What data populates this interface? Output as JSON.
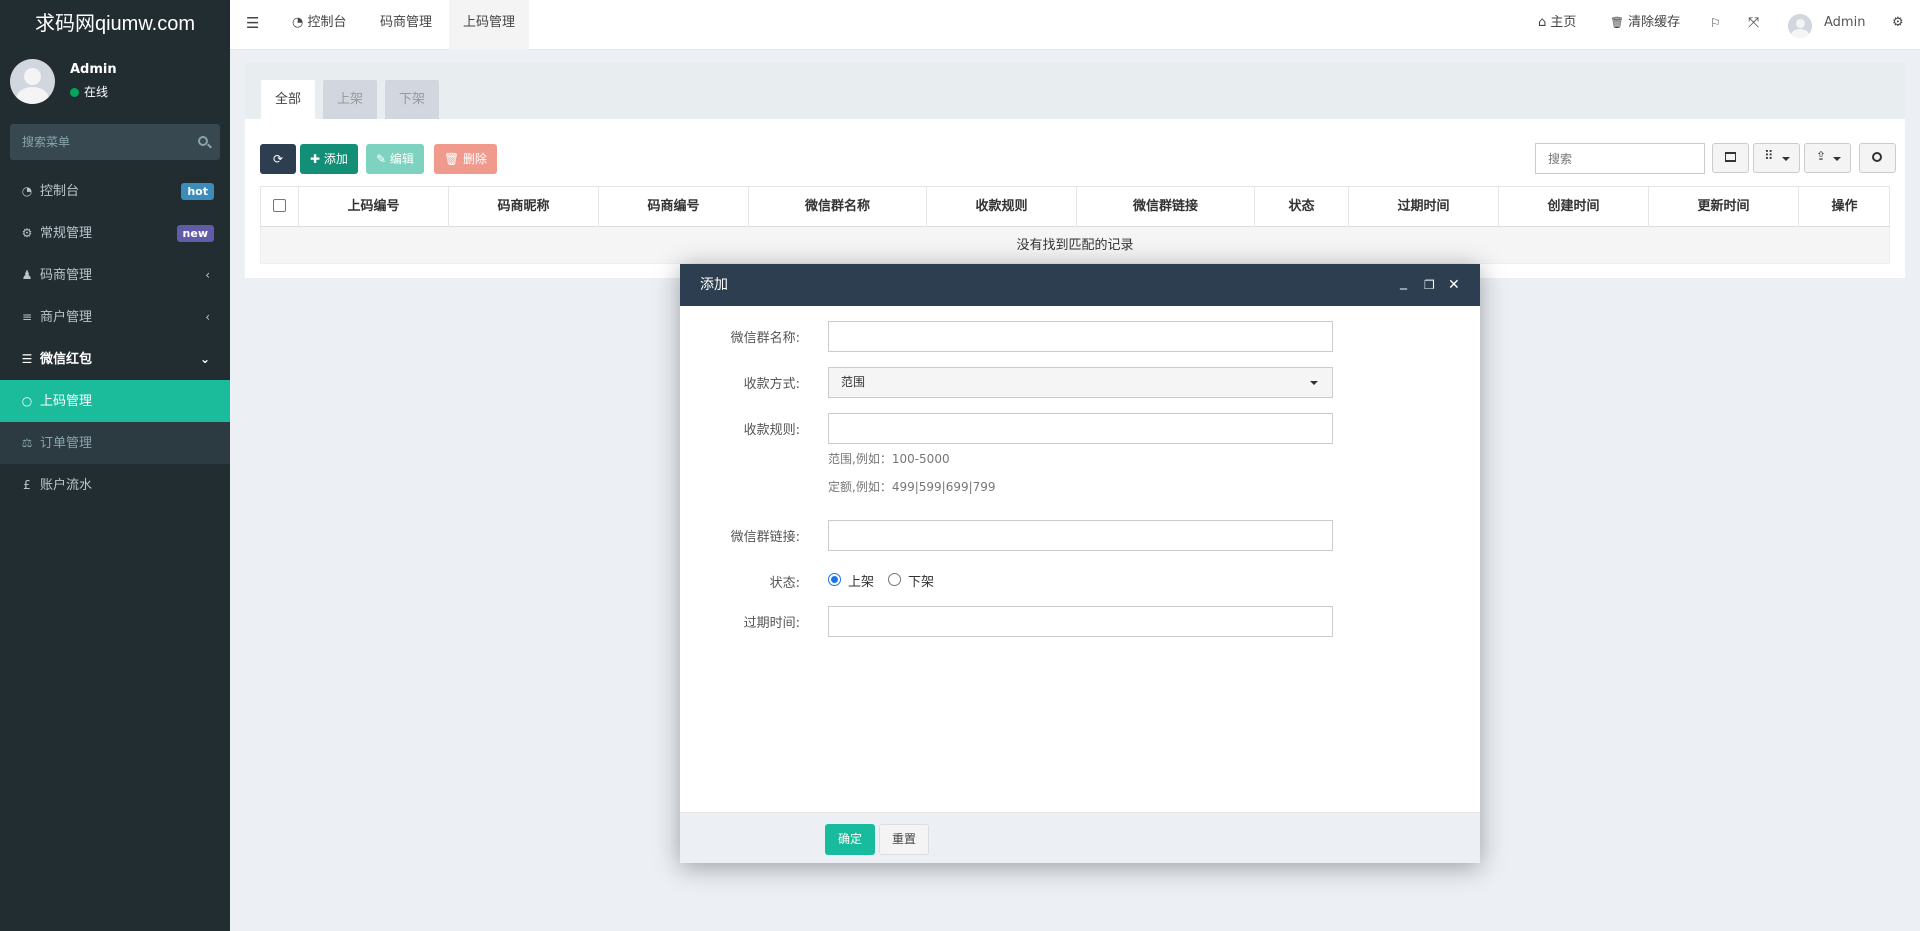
{
  "sidebar": {
    "logo": "求码网qiumw.com",
    "user_name": "Admin",
    "user_status": "在线",
    "search_placeholder": "搜索菜单",
    "items": [
      {
        "label": "控制台",
        "icon": "dashboard-icon",
        "glyph": "◔",
        "badge": "hot",
        "badge_color": "#3c8dbc"
      },
      {
        "label": "常规管理",
        "icon": "cogs-icon",
        "glyph": "⚙",
        "badge": "new",
        "badge_color": "#605ca8"
      },
      {
        "label": "码商管理",
        "icon": "users-icon",
        "glyph": "♟",
        "arrow": "‹"
      },
      {
        "label": "商户管理",
        "icon": "list-icon",
        "glyph": "≡",
        "arrow": "‹"
      },
      {
        "label": "微信红包",
        "icon": "database-icon",
        "glyph": "☰",
        "arrow": "⌄"
      },
      {
        "label": "上码管理",
        "icon": "circle-icon",
        "glyph": "○"
      },
      {
        "label": "订单管理",
        "icon": "balance-scale-icon",
        "glyph": "⚖"
      },
      {
        "label": "账户流水",
        "icon": "pound-icon",
        "glyph": "£"
      }
    ]
  },
  "header": {
    "menu_icon": "☰",
    "tabs": [
      {
        "label": "控制台",
        "icon": "dashboard-icon",
        "glyph": "◔"
      },
      {
        "label": "码商管理"
      },
      {
        "label": "上码管理"
      }
    ],
    "home_label": "主页",
    "home_glyph": "⌂",
    "clear_cache_label": "清除缓存",
    "clear_cache_glyph": "🗑",
    "user_name": "Admin"
  },
  "panel": {
    "tabs": [
      "全部",
      "上架",
      "下架"
    ],
    "buttons": {
      "add": "✚ 添加",
      "edit": "✎ 编辑",
      "delete": "🗑 删除"
    },
    "search_placeholder": "搜索",
    "columns": [
      "上码编号",
      "码商昵称",
      "码商编号",
      "微信群名称",
      "收款规则",
      "微信群链接",
      "状态",
      "过期时间",
      "创建时间",
      "更新时间",
      "操作"
    ],
    "empty_text": "没有找到匹配的记录"
  },
  "modal": {
    "title": "添加",
    "fields": {
      "group_name_label": "微信群名称:",
      "pay_method_label": "收款方式:",
      "pay_method_value": "范围",
      "pay_rule_label": "收款规则:",
      "hint_range": "范围,例如：100-5000",
      "hint_fixed": "定额,例如：499|599|699|799",
      "group_link_label": "微信群链接:",
      "status_label": "状态:",
      "status_on": "上架",
      "status_off": "下架",
      "expire_label": "过期时间:"
    },
    "confirm": "确定",
    "reset": "重置"
  },
  "colors": {
    "accent": "#1abc9c",
    "sidebar_bg": "#222d32",
    "modal_head": "#2c3e50"
  }
}
